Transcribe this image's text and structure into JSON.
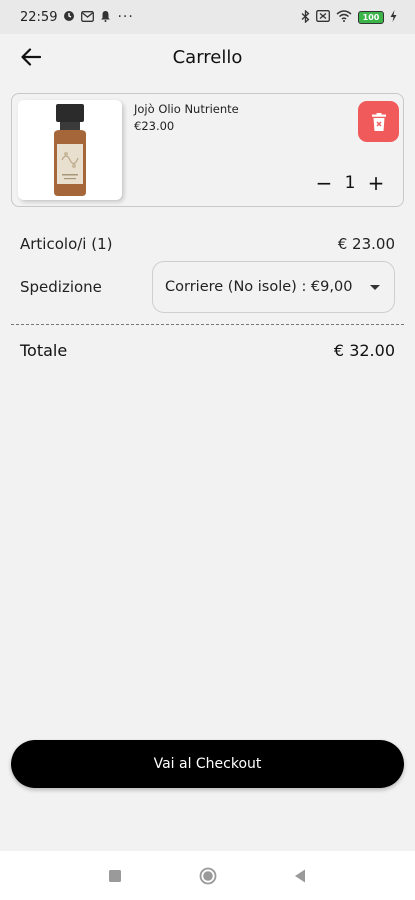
{
  "status_bar": {
    "time": "22:59",
    "left_icons": [
      "sync-icon",
      "gmail-icon",
      "bell-icon",
      "more-icon"
    ],
    "more": "···",
    "right_icons": [
      "bluetooth-icon",
      "sim-icon",
      "wifi-icon",
      "battery-icon",
      "charging-icon"
    ],
    "battery": "100"
  },
  "header": {
    "title": "Carrello",
    "back_icon": "arrow-left-icon"
  },
  "cart_item": {
    "name": "Jojò Olio Nutriente",
    "price": "€23.00",
    "quantity": "1",
    "decrement": "−",
    "increment": "+",
    "delete_icon": "trash-icon",
    "delete_color": "#f05a5a"
  },
  "summary": {
    "items_label": "Articolo/i (1)",
    "items_value": "€ 23.00",
    "shipping_label": "Spedizione",
    "shipping_selected": "Corriere (No isole) : €9,00",
    "total_label": "Totale",
    "total_value": "€ 32.00"
  },
  "checkout": {
    "label": "Vai al Checkout",
    "color": "#000000"
  },
  "nav_bar": {
    "icons": [
      "recents-square-icon",
      "home-circle-icon",
      "back-triangle-icon"
    ]
  }
}
